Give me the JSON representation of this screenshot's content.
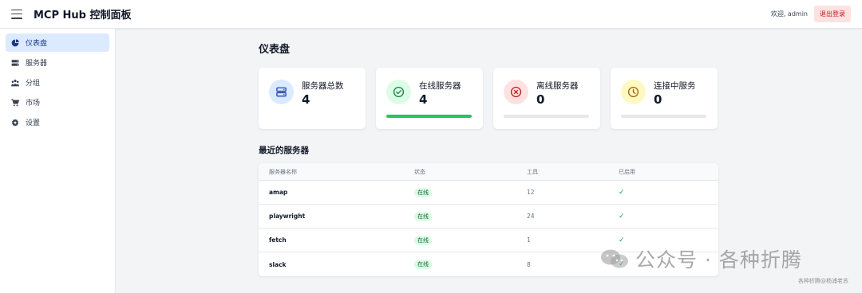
{
  "header": {
    "title": "MCP Hub 控制面板",
    "welcome": "欢迎, admin",
    "logout_label": "退出登录"
  },
  "sidebar": {
    "items": [
      {
        "label": "仪表盘",
        "icon": "pie-chart-icon",
        "active": true
      },
      {
        "label": "服务器",
        "icon": "server-icon",
        "active": false
      },
      {
        "label": "分组",
        "icon": "users-icon",
        "active": false
      },
      {
        "label": "市场",
        "icon": "cart-icon",
        "active": false
      },
      {
        "label": "设置",
        "icon": "gear-icon",
        "active": false
      }
    ]
  },
  "page": {
    "title": "仪表盘",
    "section_title": "最近的服务器"
  },
  "cards": [
    {
      "label": "服务器总数",
      "value": "4",
      "icon": "server-icon",
      "icon_color": "#1e40af",
      "icon_bg": "#dbeafe"
    },
    {
      "label": "在线服务器",
      "value": "4",
      "icon": "check-circle-icon",
      "icon_color": "#15803d",
      "icon_bg": "#dcfce7",
      "progress": 1.0
    },
    {
      "label": "离线服务器",
      "value": "0",
      "icon": "x-circle-icon",
      "icon_color": "#b91c1c",
      "icon_bg": "#fee2e2",
      "progress": 0.0
    },
    {
      "label": "连接中服务",
      "value": "0",
      "icon": "clock-icon",
      "icon_color": "#a16207",
      "icon_bg": "#fef9c3",
      "progress": 0.0
    }
  ],
  "table": {
    "columns": [
      "服务器名称",
      "状态",
      "工具",
      "已启用"
    ],
    "rows": [
      {
        "name": "amap",
        "status": "在线",
        "tools": "12",
        "enabled": "✓"
      },
      {
        "name": "playwright",
        "status": "在线",
        "tools": "24",
        "enabled": "✓"
      },
      {
        "name": "fetch",
        "status": "在线",
        "tools": "1",
        "enabled": "✓"
      },
      {
        "name": "slack",
        "status": "在线",
        "tools": "8",
        "enabled": "✓"
      }
    ]
  },
  "watermark": {
    "text": "公众号 · 各种折腾",
    "small": "各种折腾@杨浦老苏"
  },
  "colors": {
    "accent": "#1e40af",
    "success": "#22c55e",
    "danger": "#b91c1c",
    "active_nav_bg": "#dbeafe"
  }
}
